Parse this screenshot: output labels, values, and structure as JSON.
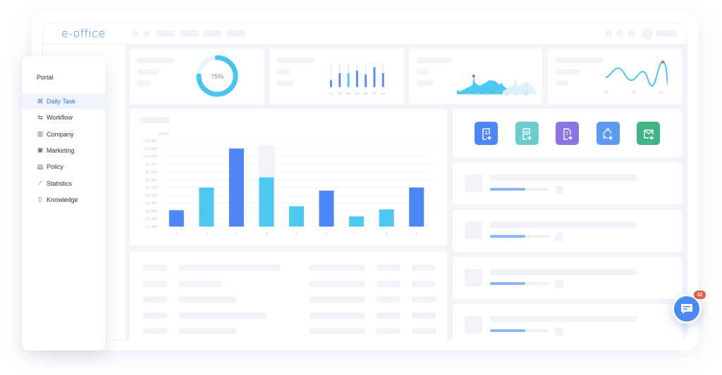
{
  "app": {
    "logo_text": "e-office"
  },
  "sidebar": {
    "section_label": "Portal",
    "items": [
      {
        "label": "Daily Task",
        "icon": "command-icon",
        "glyph": "⌘",
        "active": true
      },
      {
        "label": "Workflow",
        "icon": "workflow-icon",
        "glyph": "⇆",
        "active": false
      },
      {
        "label": "Company",
        "icon": "building-icon",
        "glyph": "▥",
        "active": false
      },
      {
        "label": "Marketing",
        "icon": "monitor-icon",
        "glyph": "▣",
        "active": false
      },
      {
        "label": "Policy",
        "icon": "document-icon",
        "glyph": "▤",
        "active": false
      },
      {
        "label": "Statistics",
        "icon": "line-chart-icon",
        "glyph": "⟋",
        "active": false
      },
      {
        "label": "Knowledge",
        "icon": "book-icon",
        "glyph": "▯",
        "active": false
      }
    ]
  },
  "colors": {
    "accent": "#4f86f7",
    "cyan": "#4dc9f1",
    "purple": "#8c74e3",
    "teal": "#6ccbcd",
    "green": "#3fb384",
    "badge": "#e25c4a"
  },
  "widgets": {
    "donut": {
      "label": "75%",
      "percent": 75
    },
    "mini_bars": {
      "labels": [
        "02",
        "03",
        "04",
        "05",
        "06",
        "07",
        "08"
      ],
      "values": [
        0.3,
        0.58,
        0.58,
        0.68,
        0.53,
        0.82,
        0.58
      ],
      "highlight_index": 2
    },
    "area": {
      "labels": [
        "02",
        "03",
        "04",
        "05",
        "06",
        "07",
        "08"
      ]
    },
    "wave": {
      "labels": [
        "03",
        "06",
        "09"
      ]
    }
  },
  "chart_data": {
    "type": "bar",
    "title": "",
    "ylabel": "(SGD)",
    "xlabel": "",
    "categories": [
      "1",
      "2",
      "3",
      "4",
      "5",
      "6",
      "7",
      "8",
      "9"
    ],
    "values": [
      31000,
      60000,
      110000,
      73000,
      36000,
      56000,
      23000,
      32000,
      60000
    ],
    "highlight_background": {
      "category": "4",
      "value": 114000
    },
    "yticks": [
      "120,000",
      "110,000",
      "100,000",
      "90,000",
      "80,000",
      "70,000",
      "60,000",
      "50,000",
      "40,000",
      "30,000",
      "20,000",
      "10,000"
    ],
    "ylim": [
      10000,
      120000
    ],
    "grid": true,
    "bar_colors": [
      "#4f86f7",
      "#4dc9f1",
      "#4f86f7",
      "#4dc9f1",
      "#4dc9f1",
      "#4f86f7",
      "#4dc9f1",
      "#4dc9f1",
      "#4f86f7"
    ]
  },
  "quick_actions": [
    {
      "name": "new-workflow-button",
      "icon": "workflow-doc-add-icon",
      "color": "#4f86f7"
    },
    {
      "name": "new-favorite-doc-button",
      "icon": "star-doc-add-icon",
      "color": "#6ccbcd"
    },
    {
      "name": "new-document-button",
      "icon": "doc-add-icon",
      "color": "#8c74e3"
    },
    {
      "name": "new-process-button",
      "icon": "node-add-icon",
      "color": "#5b9af0"
    },
    {
      "name": "new-mail-button",
      "icon": "mail-add-icon",
      "color": "#3fb384"
    }
  ],
  "task_list": [
    {
      "progress": 0.59
    },
    {
      "progress": 0.59
    },
    {
      "progress": 0.59
    },
    {
      "progress": 0.59
    }
  ],
  "chat": {
    "badge_count": "32"
  }
}
